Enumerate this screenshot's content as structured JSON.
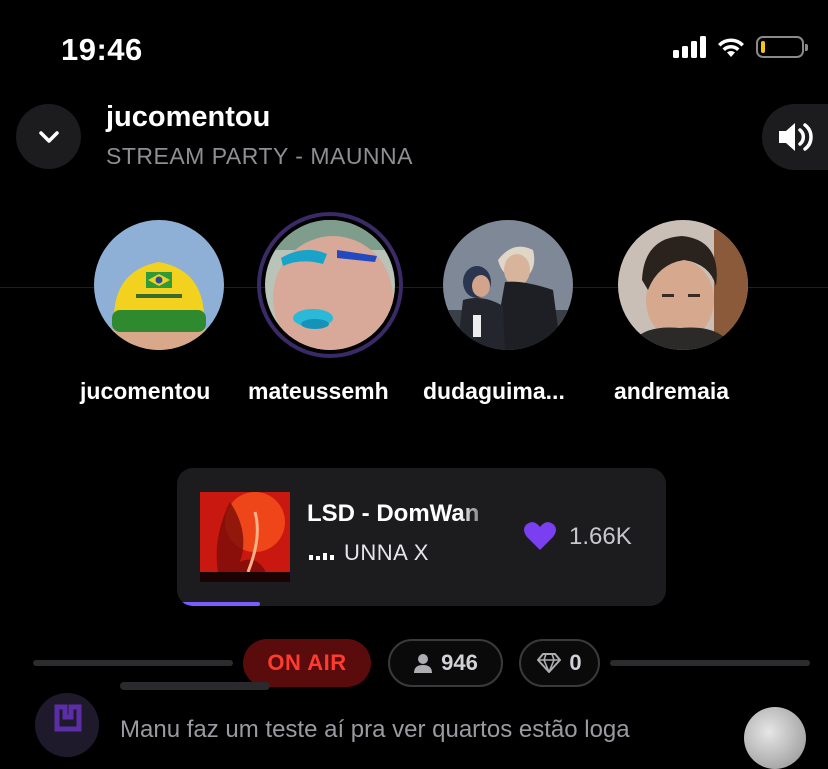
{
  "status_bar": {
    "time": "19:46",
    "icons": [
      "cellular-signal-icon",
      "wifi-icon",
      "battery-icon"
    ],
    "battery_level": 0.1,
    "battery_color": "#f5c518"
  },
  "header": {
    "title": "jucomentou",
    "subtitle": "STREAM PARTY - MAUNNA",
    "collapse_icon": "chevron-down-icon",
    "volume_icon": "speaker-volume-icon"
  },
  "participants": [
    {
      "name": "jucomentou",
      "avatar": "avatar-yellow-cap"
    },
    {
      "name": "mateussemh",
      "avatar": "avatar-blue-makeup",
      "active": true
    },
    {
      "name": "dudaguima...",
      "avatar": "avatar-couple"
    },
    {
      "name": "andremaia",
      "avatar": "avatar-portrait"
    }
  ],
  "now_playing": {
    "title": "LSD - DomWan",
    "artist": "UNNA X",
    "likes": "1.66K",
    "progress": 0.17,
    "heart_color": "#7b3ff2",
    "progress_color": "#7b5cff"
  },
  "stats": {
    "status": "ON AIR",
    "status_color": "#ff3b30",
    "listeners": "946",
    "diamonds": "0"
  },
  "chat": {
    "message": "Manu faz um teste aí pra ver quartos estão loga"
  }
}
